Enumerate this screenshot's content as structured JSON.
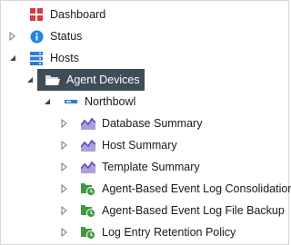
{
  "tree": {
    "items": [
      {
        "label": "Dashboard",
        "icon": "dashboard-icon",
        "expanded": null
      },
      {
        "label": "Status",
        "icon": "info-icon",
        "expanded": false
      },
      {
        "label": "Hosts",
        "icon": "server-icon",
        "expanded": true
      },
      {
        "label": "Agent Devices",
        "icon": "folder-icon",
        "expanded": true,
        "selected": true
      },
      {
        "label": "Northbowl",
        "icon": "device-icon",
        "expanded": true
      },
      {
        "label": "Database Summary",
        "icon": "chart-icon",
        "expanded": false
      },
      {
        "label": "Host Summary",
        "icon": "chart-icon",
        "expanded": false
      },
      {
        "label": "Template Summary",
        "icon": "chart-icon",
        "expanded": false
      },
      {
        "label": "Agent-Based Event Log Consolidation",
        "icon": "policy-clock-icon",
        "expanded": false
      },
      {
        "label": "Agent-Based Event Log File Backup",
        "icon": "policy-clock-icon",
        "expanded": false
      },
      {
        "label": "Log Entry Retention Policy",
        "icon": "policy-clock-icon",
        "expanded": false
      }
    ]
  },
  "colors": {
    "selected_bg": "#3f4d57",
    "dashboard_red": "#d9393f",
    "info_blue": "#1e88e5",
    "server_blue": "#2b7fd0",
    "chart_purple": "#6a4fc0",
    "policy_green": "#3f9a3f"
  }
}
